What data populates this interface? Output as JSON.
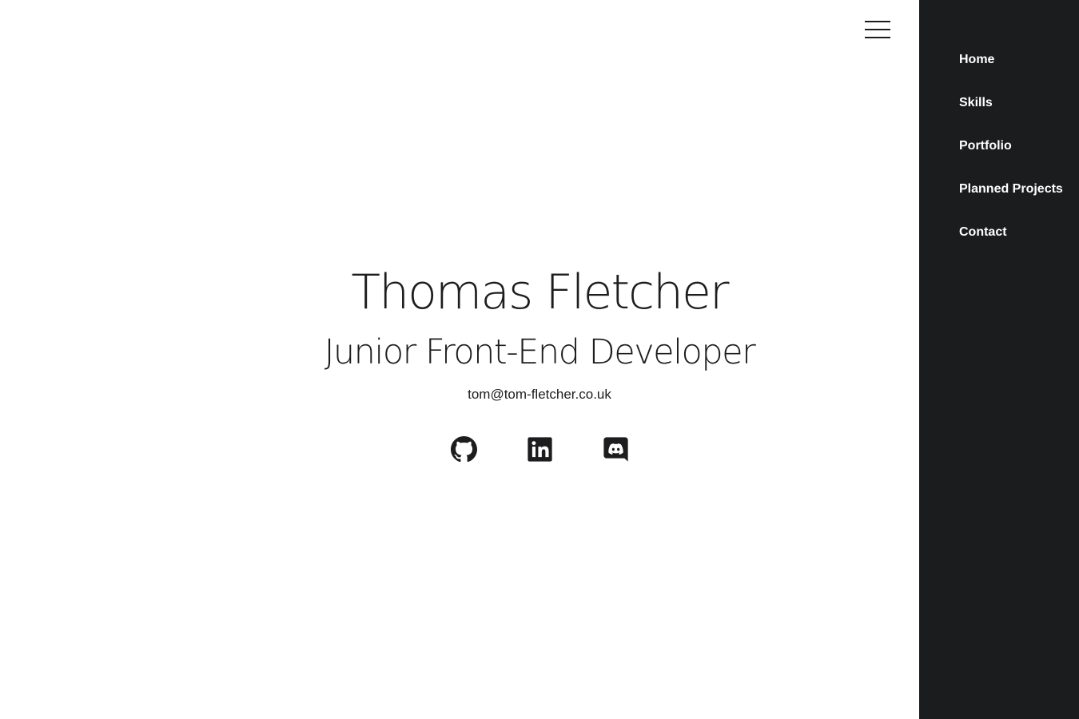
{
  "hero": {
    "name": "Thomas Fletcher",
    "role": "Junior Front-End Developer",
    "email": "tom@tom-fletcher.co.uk"
  },
  "socials": [
    {
      "icon": "github-icon"
    },
    {
      "icon": "linkedin-icon"
    },
    {
      "icon": "discord-icon"
    }
  ],
  "menu": {
    "icon": "hamburger-menu-icon"
  },
  "nav": {
    "items": [
      {
        "label": "Home"
      },
      {
        "label": "Skills"
      },
      {
        "label": "Portfolio"
      },
      {
        "label": "Planned Projects"
      },
      {
        "label": "Contact"
      }
    ]
  },
  "colors": {
    "text": "#1d1d1f",
    "sidebar_bg": "#1b1c1d",
    "sidebar_text": "#ffffff",
    "background": "#ffffff"
  }
}
